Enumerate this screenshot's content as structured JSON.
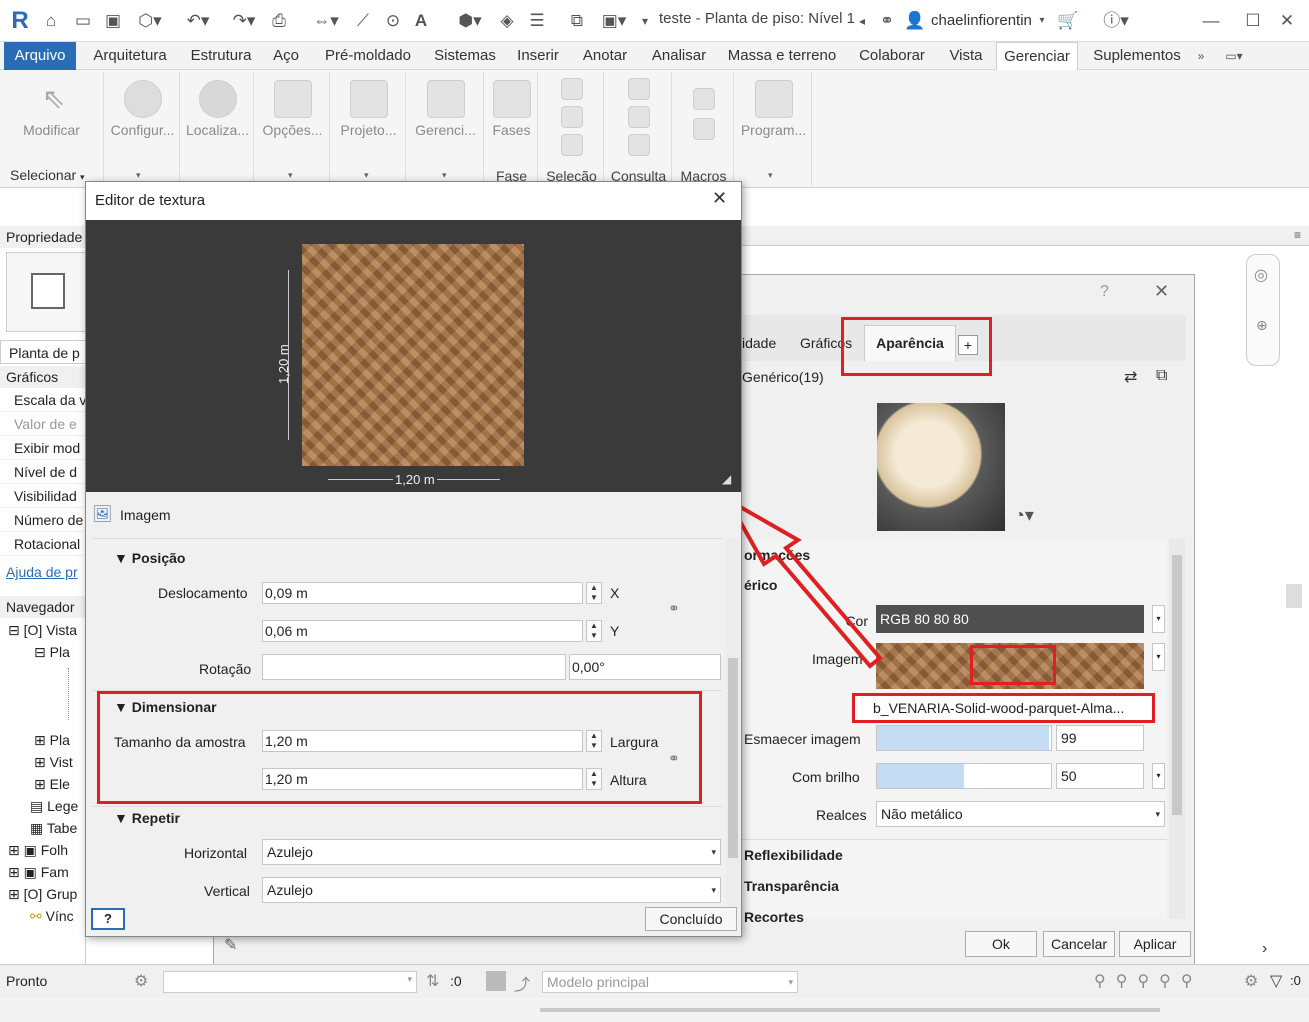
{
  "titlebar": {
    "logo": "R",
    "title": "teste - Planta de piso: Nível 1",
    "user": "chaelinfiorentin"
  },
  "menu": {
    "tabs": [
      "Arquivo",
      "Arquitetura",
      "Estrutura",
      "Aço",
      "Pré-moldado",
      "Sistemas",
      "Inserir",
      "Anotar",
      "Analisar",
      "Massa e terreno",
      "Colaborar",
      "Vista",
      "Gerenciar",
      "Suplementos"
    ]
  },
  "ribbon": {
    "buttons": [
      "Modificar",
      "Configur...",
      "Localiza...",
      "Opções...",
      "Projeto...",
      "Gerenci...",
      "Fases",
      "Program..."
    ],
    "groups": [
      "Selecionar",
      "Fase",
      "Seleção",
      "Consulta",
      "Macros"
    ]
  },
  "props": {
    "title": "Propriedade",
    "type": "Planta de p",
    "rows": [
      "Gráficos",
      "Escala da v",
      "Valor de e",
      "Exibir mod",
      "Nível de d",
      "Visibilidad",
      "Número de",
      "Rotacional"
    ],
    "help": "Ajuda de pr"
  },
  "navigator": {
    "title": "Navegador",
    "items": [
      "Vista",
      "Pla",
      "Pla",
      "Vist",
      "Ele",
      "Lege",
      "Tabe",
      "Folh",
      "Fam",
      "Grup",
      "Vínc"
    ]
  },
  "texture": {
    "title": "Editor de textura",
    "dim_h": "1,20 m",
    "dim_v": "1,20 m",
    "image_label": "Imagem",
    "position_header": "Posição",
    "offset_label": "Deslocamento",
    "offset_x": "0,09 m",
    "offset_y": "0,06 m",
    "axis_x": "X",
    "axis_y": "Y",
    "rotation_label": "Rotação",
    "rotation_value": "0,00°",
    "scale_header": "Dimensionar",
    "sample_label": "Tamanho da amostra",
    "width_value": "1,20 m",
    "height_value": "1,20 m",
    "width_label": "Largura",
    "height_label": "Altura",
    "repeat_header": "Repetir",
    "horizontal_label": "Horizontal",
    "horizontal_value": "Azulejo",
    "vertical_label": "Vertical",
    "vertical_value": "Azulejo",
    "done": "Concluído",
    "help": "?"
  },
  "material": {
    "help": "?",
    "tab_identity": "idade",
    "tab_graphics": "Gráficos",
    "tab_appearance": "Aparência",
    "tab_add": "+",
    "asset_name": "Genérico(19)",
    "section_info": "ormações",
    "section_generic": "érico",
    "color_label": "Cor",
    "color_value": "RGB 80 80 80",
    "image_label": "Imagem",
    "image_file": "b_VENARIA-Solid-wood-parquet-Alma...",
    "fade_label": "Esmaecer imagem",
    "fade_value": "99",
    "fade_fraction": 0.99,
    "gloss_label": "Com brilho",
    "gloss_value": "50",
    "gloss_fraction": 0.5,
    "highlight_label": "Realces",
    "highlight_value": "Não metálico",
    "section_reflect": "Reflexibilidade",
    "section_transp": "Transparência",
    "section_cut": "Recortes",
    "ok": "Ok",
    "cancel": "Cancelar",
    "apply": "Aplicar"
  },
  "status": {
    "ready": "Pronto",
    "zero": ":0",
    "model": "Modelo principal",
    "filter": ":0"
  },
  "colors": {
    "accent": "#2a6db5",
    "highlight": "#e02020",
    "preview_bg": "#3a3a3a"
  }
}
